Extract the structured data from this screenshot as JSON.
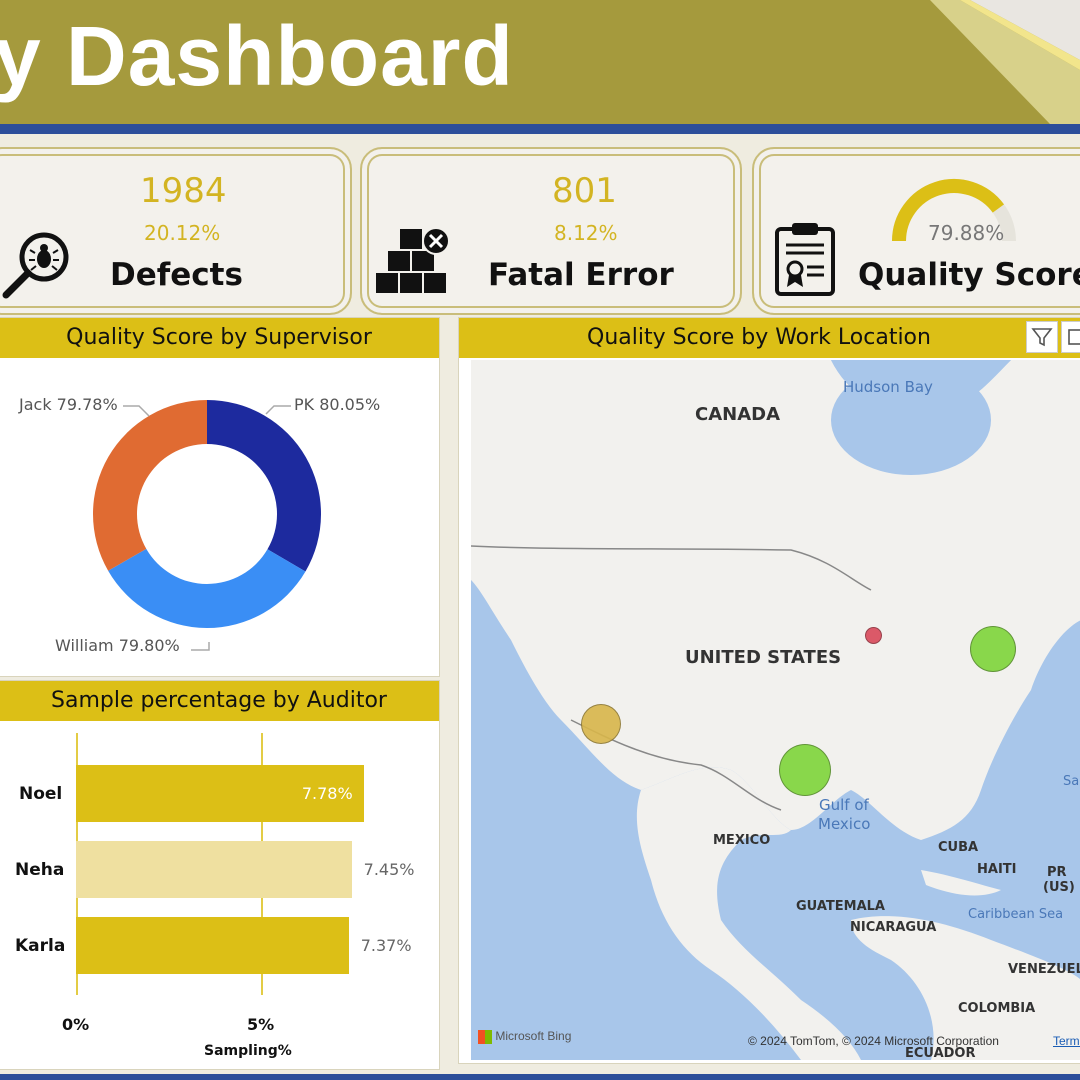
{
  "header": {
    "title": "y Dashboard"
  },
  "kpis": {
    "defects": {
      "value": "1984",
      "percent": "20.12%",
      "label": "Defects",
      "icon": "bug-search-icon"
    },
    "fatal_error": {
      "value": "801",
      "percent": "8.12%",
      "label": "Fatal Error",
      "icon": "boxes-error-icon"
    },
    "quality_score": {
      "percent": "79.88%",
      "gauge_fraction": 0.7988,
      "label": "Quality Score",
      "icon": "certificate-clipboard-icon"
    }
  },
  "supervisor_panel": {
    "title": "Quality Score by Supervisor",
    "chart_data": {
      "type": "pie",
      "donut": true,
      "slices": [
        {
          "name": "PK",
          "value": 80.05,
          "label": "PK 80.05%",
          "color": "#1d2a9e"
        },
        {
          "name": "William",
          "value": 79.8,
          "label": "William 79.80%",
          "color": "#3a8ef5"
        },
        {
          "name": "Jack",
          "value": 79.78,
          "label": "Jack 79.78%",
          "color": "#e06b32"
        }
      ]
    }
  },
  "auditor_panel": {
    "title": "Sample percentage by Auditor",
    "chart_data": {
      "type": "bar",
      "orientation": "horizontal",
      "categories": [
        "Noel",
        "Neha",
        "Karla"
      ],
      "values": [
        7.78,
        7.45,
        7.37
      ],
      "value_labels": [
        "7.78%",
        "7.45%",
        "7.37%"
      ],
      "xlabel": "Sampling%",
      "xlim": [
        0,
        8
      ],
      "ticks": [
        "0%",
        "5%"
      ],
      "colors": [
        "#dcbf16",
        "#efe0a0",
        "#dcbf16"
      ]
    }
  },
  "map_panel": {
    "title": "Quality Score by Work Location",
    "labels": {
      "canada": "CANADA",
      "us": "UNITED STATES",
      "mexico": "MEXICO",
      "cuba": "CUBA",
      "haiti": "HAITI",
      "pr": "PR",
      "pr2": "(US)",
      "guatemala": "GUATEMALA",
      "nicaragua": "NICARAGUA",
      "venezuela": "VENEZUEL",
      "colombia": "COLOMBIA",
      "ecuador": "ECUADOR",
      "hudson": "Hudson Bay",
      "gulf1": "Gulf of",
      "gulf2": "Mexico",
      "caribbean": "Caribbean Sea",
      "sa": "Sa"
    },
    "bing": "Microsoft Bing",
    "copyright": "© 2024 TomTom, © 2024 Microsoft Corporation",
    "terms": "Terms",
    "bubble_colors": {
      "green": "#7ed53a",
      "gold": "#d8b64a",
      "red": "#d9495a"
    }
  }
}
